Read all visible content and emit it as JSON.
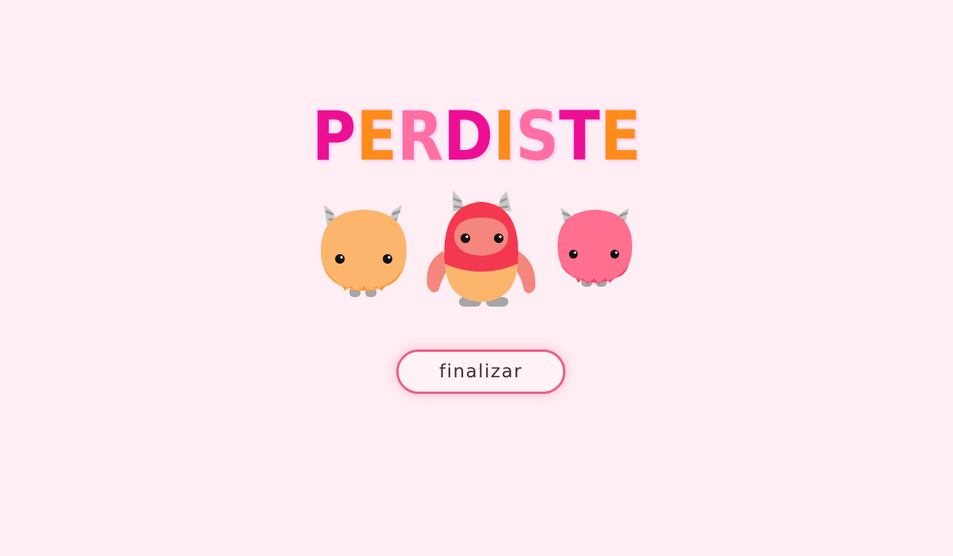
{
  "title": {
    "letters": [
      {
        "char": "P",
        "color": "#ec0f93"
      },
      {
        "char": "E",
        "color": "#ff8c1a"
      },
      {
        "char": "R",
        "color": "#ff6fa3"
      },
      {
        "char": "D",
        "color": "#ec0f93"
      },
      {
        "char": "I",
        "color": "#ff8c1a"
      },
      {
        "char": "S",
        "color": "#ff6fa3"
      },
      {
        "char": "T",
        "color": "#ec0f93"
      },
      {
        "char": "E",
        "color": "#ff8c1a"
      }
    ]
  },
  "monsters": [
    {
      "name": "orange-monster",
      "body_color": "#fbb56d"
    },
    {
      "name": "red-monster",
      "body_color": "#f4384f"
    },
    {
      "name": "pink-monster",
      "body_color": "#ff6f8f"
    }
  ],
  "colors": {
    "background": "#ffeef3",
    "button_border": "#ec5f88"
  },
  "button": {
    "label": "finalizar"
  }
}
